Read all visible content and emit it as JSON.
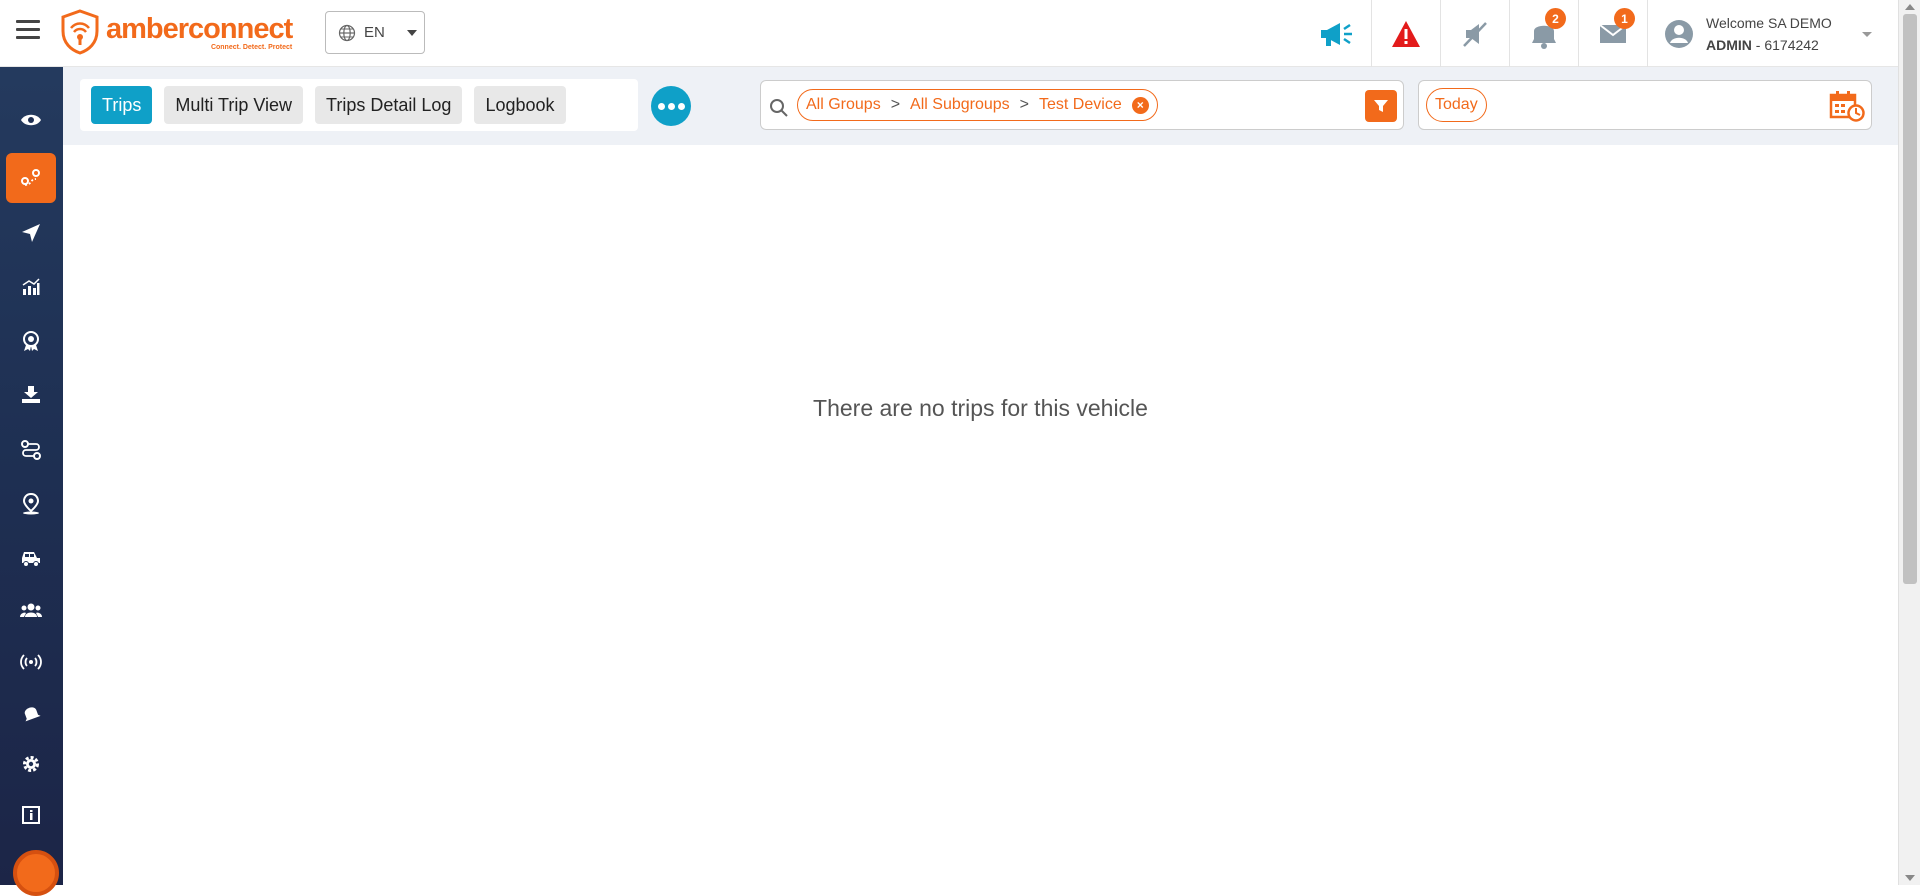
{
  "brand": {
    "name": "amberconnect",
    "tagline": "Connect. Detect. Protect",
    "color": "#f26a1b"
  },
  "language": {
    "selected": "EN"
  },
  "header": {
    "icons": [
      {
        "name": "megaphone-icon"
      },
      {
        "name": "alert-icon"
      },
      {
        "name": "mute-icon"
      },
      {
        "name": "notification-bell-icon",
        "badge": "2"
      },
      {
        "name": "mail-icon",
        "badge": "1"
      }
    ],
    "user": {
      "welcome": "Welcome SA DEMO",
      "role": "ADMIN",
      "id": " - 6174242"
    }
  },
  "sidebar": {
    "items": [
      {
        "name": "eye-icon"
      },
      {
        "name": "trips-route-icon",
        "active": true
      },
      {
        "name": "navigation-icon"
      },
      {
        "name": "reports-chart-icon"
      },
      {
        "name": "award-icon"
      },
      {
        "name": "download-icon"
      },
      {
        "name": "routes-icon"
      },
      {
        "name": "geofence-pin-icon"
      },
      {
        "name": "vehicles-icon"
      },
      {
        "name": "users-icon"
      },
      {
        "name": "devices-signal-icon"
      },
      {
        "name": "alerts-bell-icon"
      },
      {
        "name": "settings-gear-icon"
      },
      {
        "name": "info-icon"
      }
    ]
  },
  "tabs": [
    {
      "label": "Trips",
      "active": true
    },
    {
      "label": "Multi Trip View"
    },
    {
      "label": "Trips Detail Log"
    },
    {
      "label": "Logbook"
    }
  ],
  "filter": {
    "group": "All Groups",
    "subgroup": "All Subgroups",
    "device": "Test Device",
    "separator": ">"
  },
  "date_filter": {
    "label": "Today"
  },
  "main": {
    "empty_message": "There are no trips for this vehicle"
  },
  "colors": {
    "accent": "#f26a1b",
    "primary": "#0fa0c8",
    "sidebar": "#1e2f52"
  }
}
